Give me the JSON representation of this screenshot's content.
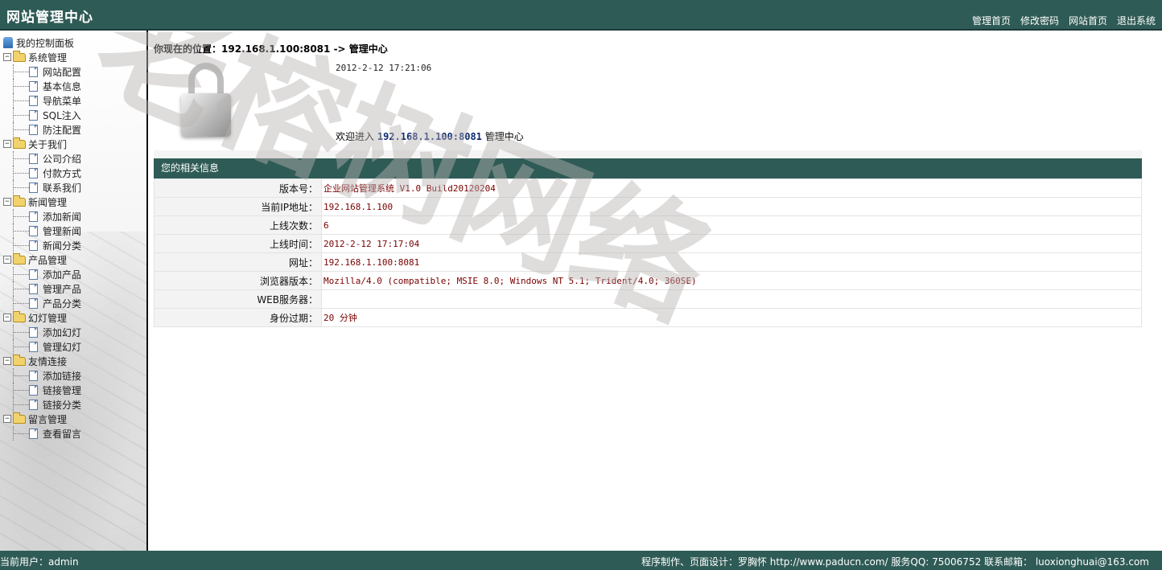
{
  "header": {
    "title": "网站管理中心",
    "nav": [
      "管理首页",
      "修改密码",
      "网站首页",
      "退出系统"
    ]
  },
  "sidebar": {
    "root_label": "我的控制面板",
    "groups": [
      {
        "label": "系统管理",
        "items": [
          "网站配置",
          "基本信息",
          "导航菜单",
          "SQL注入",
          "防注配置"
        ]
      },
      {
        "label": "关于我们",
        "items": [
          "公司介绍",
          "付款方式",
          "联系我们"
        ]
      },
      {
        "label": "新闻管理",
        "items": [
          "添加新闻",
          "管理新闻",
          "新闻分类"
        ]
      },
      {
        "label": "产品管理",
        "items": [
          "添加产品",
          "管理产品",
          "产品分类"
        ]
      },
      {
        "label": "幻灯管理",
        "items": [
          "添加幻灯",
          "管理幻灯"
        ]
      },
      {
        "label": "友情连接",
        "items": [
          "添加链接",
          "链接管理",
          "链接分类"
        ]
      },
      {
        "label": "留言管理",
        "items": [
          "查看留言"
        ]
      }
    ]
  },
  "main": {
    "location_prefix": "你现在的位置：",
    "location_path": "192.168.1.100:8081 -> 管理中心",
    "timestamp": "2012-2-12 17:21:06",
    "welcome_prefix": "欢迎进入",
    "welcome_host": "192.168.1.100:8081",
    "welcome_suffix": "管理中心",
    "info_title": "您的相关信息",
    "info_rows": [
      {
        "key": "版本号：",
        "value": "企业网站管理系统 V1.0 Build20120204"
      },
      {
        "key": "当前IP地址：",
        "value": "192.168.1.100"
      },
      {
        "key": "上线次数：",
        "value": "6"
      },
      {
        "key": "上线时间：",
        "value": "2012-2-12 17:17:04"
      },
      {
        "key": "网址：",
        "value": "192.168.1.100:8081"
      },
      {
        "key": "浏览器版本：",
        "value": "Mozilla/4.0 (compatible; MSIE 8.0; Windows NT 5.1; Trident/4.0; 360SE)"
      },
      {
        "key": "WEB服务器：",
        "value": ""
      },
      {
        "key": "身份过期：",
        "value": "20 分钟"
      }
    ]
  },
  "footer": {
    "user_label": "当前用户：admin",
    "credits": "程序制作、页面设计：罗胸怀   http://www.paducn.com/   服务QQ: 75006752   联系邮箱： luoxionghuai@163.com"
  },
  "watermark": {
    "text": "老榕树网络"
  },
  "icons": {
    "root": "monitor-icon",
    "group": "folder-open-icon",
    "item": "page-icon",
    "info": "lock-icon"
  },
  "colors": {
    "header_bg": "#2f5b56",
    "value_text": "#7a0000"
  }
}
